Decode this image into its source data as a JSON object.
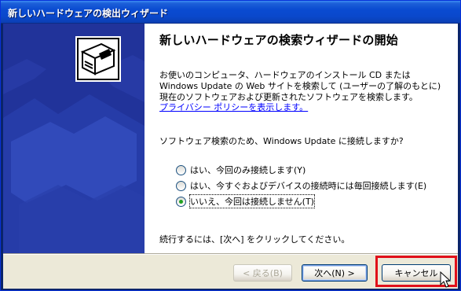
{
  "window": {
    "title": "新しいハードウェアの検出ウィザード"
  },
  "page": {
    "heading": "新しいハードウェアの検索ウィザードの開始",
    "description": "お使いのコンピュータ、ハードウェアのインストール CD または Windows Update の Web サイトを検索して (ユーザーの了解のもとに) 現在のソフトウェアおよび更新されたソフトウェアを検索します。",
    "privacy_link": "プライバシー ポリシーを表示します。",
    "question": "ソフトウェア検索のため、Windows Update に接続しますか?",
    "options": [
      {
        "label": "はい、今回のみ接続します(Y)",
        "checked": false
      },
      {
        "label": "はい、今すぐおよびデバイスの接続時には毎回接続します(E)",
        "checked": false
      },
      {
        "label": "いいえ、今回は接続しません(T)",
        "checked": true
      }
    ],
    "continue_text": "続行するには、[次へ] をクリックしてください。"
  },
  "buttons": {
    "back": "< 戻る(B)",
    "next": "次へ(N) >",
    "cancel": "キャンセル"
  },
  "icons": {
    "wizard": "hardware-box-icon",
    "cursor": "mouse-pointer-icon"
  },
  "colors": {
    "title_bar": "#0a4bd1",
    "side_panel": "#21339a",
    "highlight": "#e0101a",
    "link": "#0000ff"
  }
}
